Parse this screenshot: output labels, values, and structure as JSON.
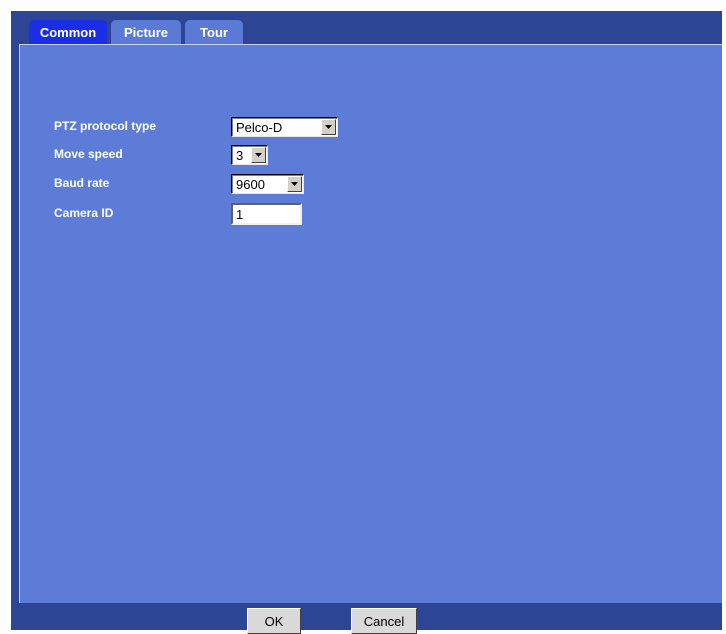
{
  "tabs": [
    {
      "label": "Common",
      "active": true
    },
    {
      "label": "Picture",
      "active": false
    },
    {
      "label": "Tour",
      "active": false
    }
  ],
  "form": {
    "ptz_protocol_label": "PTZ protocol type",
    "ptz_protocol_value": "Pelco-D",
    "move_speed_label": "Move speed",
    "move_speed_value": "3",
    "baud_rate_label": "Baud rate",
    "baud_rate_value": "9600",
    "camera_id_label": "Camera ID",
    "camera_id_value": "1"
  },
  "buttons": {
    "ok_label": "OK",
    "cancel_label": "Cancel"
  },
  "colors": {
    "frame": "#2d4595",
    "panel": "#5d7cd7",
    "active_tab": "#1a2ee6",
    "inactive_tab": "#5a7ad6"
  }
}
